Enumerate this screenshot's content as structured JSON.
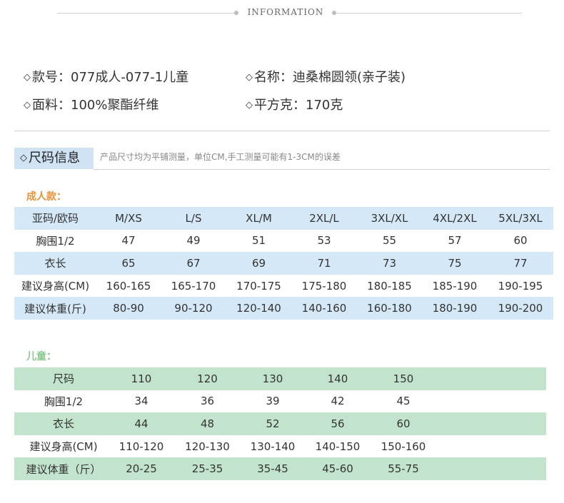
{
  "header": {
    "title": "INFORMATION"
  },
  "product_info": {
    "marker": "◇",
    "style_no": "款号：077成人-077-1儿童",
    "name": "名称：迪桑棉圆领(亲子装)",
    "material": "面料：100%聚酯纤维",
    "weight": "平方克：170克"
  },
  "size_section": {
    "title": "尺码信息",
    "note": "产品尺寸均为平铺测量，单位CM,手工测量可能有1-3CM的误差"
  },
  "colors": {
    "adult_label": "#e8923a",
    "kids_label": "#8cc890",
    "adult_row": "#d4e8f8",
    "kids_row": "#c2e4cc",
    "tag_bg": "#cfe3f5"
  },
  "adult": {
    "label": "成人款：",
    "rows": [
      [
        "亚码/欧码",
        "M/XS",
        "L/S",
        "XL/M",
        "2XL/L",
        "3XL/XL",
        "4XL/2XL",
        "5XL/3XL"
      ],
      [
        "胸围1/2",
        "47",
        "49",
        "51",
        "53",
        "55",
        "57",
        "60"
      ],
      [
        "衣长",
        "65",
        "67",
        "69",
        "71",
        "73",
        "75",
        "77"
      ],
      [
        "建议身高(CM)",
        "160-165",
        "165-170",
        "170-175",
        "175-180",
        "180-185",
        "185-190",
        "190-195"
      ],
      [
        "建议体重(斤)",
        "80-90",
        "90-120",
        "120-140",
        "140-160",
        "160-180",
        "180-190",
        "190-200"
      ]
    ]
  },
  "kids": {
    "label": "儿童：",
    "rows": [
      [
        "尺码",
        "110",
        "120",
        "130",
        "140",
        "150"
      ],
      [
        "胸围1/2",
        "34",
        "36",
        "39",
        "42",
        "45"
      ],
      [
        "衣长",
        "44",
        "48",
        "52",
        "56",
        "60"
      ],
      [
        "建议身高(CM)",
        "110-120",
        "120-130",
        "130-140",
        "140-150",
        "150-160"
      ],
      [
        "建议体重（斤）",
        "20-25",
        "25-35",
        "35-45",
        "45-60",
        "55-75"
      ]
    ]
  }
}
